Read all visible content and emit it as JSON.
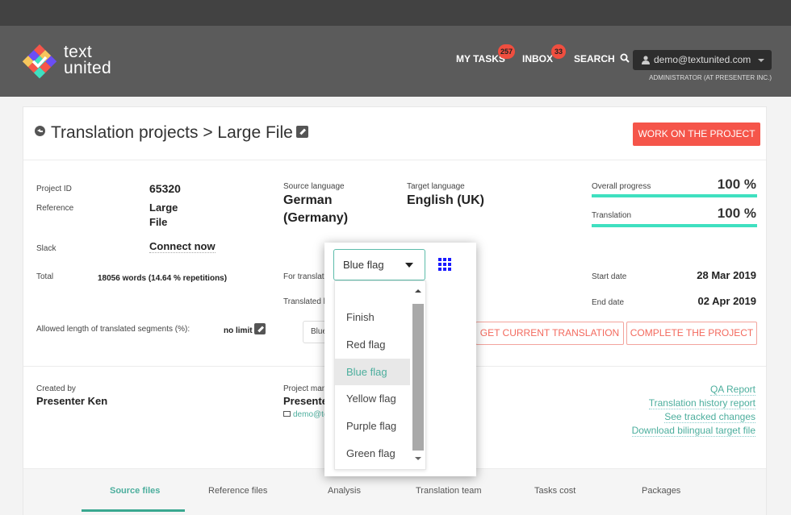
{
  "brand": {
    "line1": "text",
    "line2": "united"
  },
  "nav": {
    "my_tasks": "MY TASKS",
    "my_tasks_badge": "257",
    "inbox": "INBOX",
    "inbox_badge": "33",
    "search": "SEARCH",
    "user_email": "demo@textunited.com",
    "user_role": "ADMINISTRATOR (AT PRESENTER INC.)"
  },
  "page": {
    "breadcrumb_parent": "Translation projects",
    "breadcrumb_sep": ">",
    "breadcrumb_current": "Large File",
    "work_button": "WORK ON THE PROJECT"
  },
  "details": {
    "project_id_label": "Project ID",
    "project_id": "65320",
    "reference_label": "Reference",
    "reference_line1": "Large",
    "reference_line2": "File",
    "slack_label": "Slack",
    "slack_value": "Connect now",
    "total_label": "Total",
    "total_value": "18056 words (14.64 % repetitions)",
    "allowed_length_label": "Allowed length of translated segments (%):",
    "allowed_length_value": "no limit",
    "source_language_label": "Source language",
    "source_language_line1": "German",
    "source_language_line2": "(Germany)",
    "target_language_label": "Target language",
    "target_language": "English (UK)",
    "for_translation_label": "For translati",
    "translated_by_label": "Translated b",
    "background_select_value": "Blue"
  },
  "progress": {
    "overall_label": "Overall progress",
    "overall_value": "100 %",
    "overall_fraction": 1.0,
    "translation_label": "Translation",
    "translation_value": "100 %",
    "translation_fraction": 1.0,
    "start_date_label": "Start date",
    "start_date": "28 Mar 2019",
    "end_date_label": "End date",
    "end_date": "02 Apr 2019"
  },
  "actions": {
    "get_translation": "GET CURRENT TRANSLATION",
    "complete_project": "COMPLETE THE PROJECT"
  },
  "people": {
    "created_by_label": "Created by",
    "created_by": "Presenter Ken",
    "project_manager_label": "Project man",
    "project_manager": "Presente",
    "project_manager_email": "demo@te"
  },
  "reports": [
    "QA Report",
    "Translation history report",
    "See tracked changes",
    "Download bilingual target file"
  ],
  "tabs": [
    {
      "label": "Source files",
      "active": true
    },
    {
      "label": "Reference files",
      "active": false
    },
    {
      "label": "Analysis",
      "active": false
    },
    {
      "label": "Translation team",
      "active": false
    },
    {
      "label": "Tasks cost",
      "active": false
    },
    {
      "label": "Packages",
      "active": false
    }
  ],
  "flag_dropdown": {
    "selected": "Blue flag",
    "options": [
      "Finish",
      "Red flag",
      "Blue flag",
      "Yellow flag",
      "Purple flag",
      "Green flag"
    ],
    "selected_index": 2
  },
  "colors": {
    "accent_red": "#f5554a",
    "accent_teal": "#4cae9d",
    "progress": "#3fe0c0"
  }
}
